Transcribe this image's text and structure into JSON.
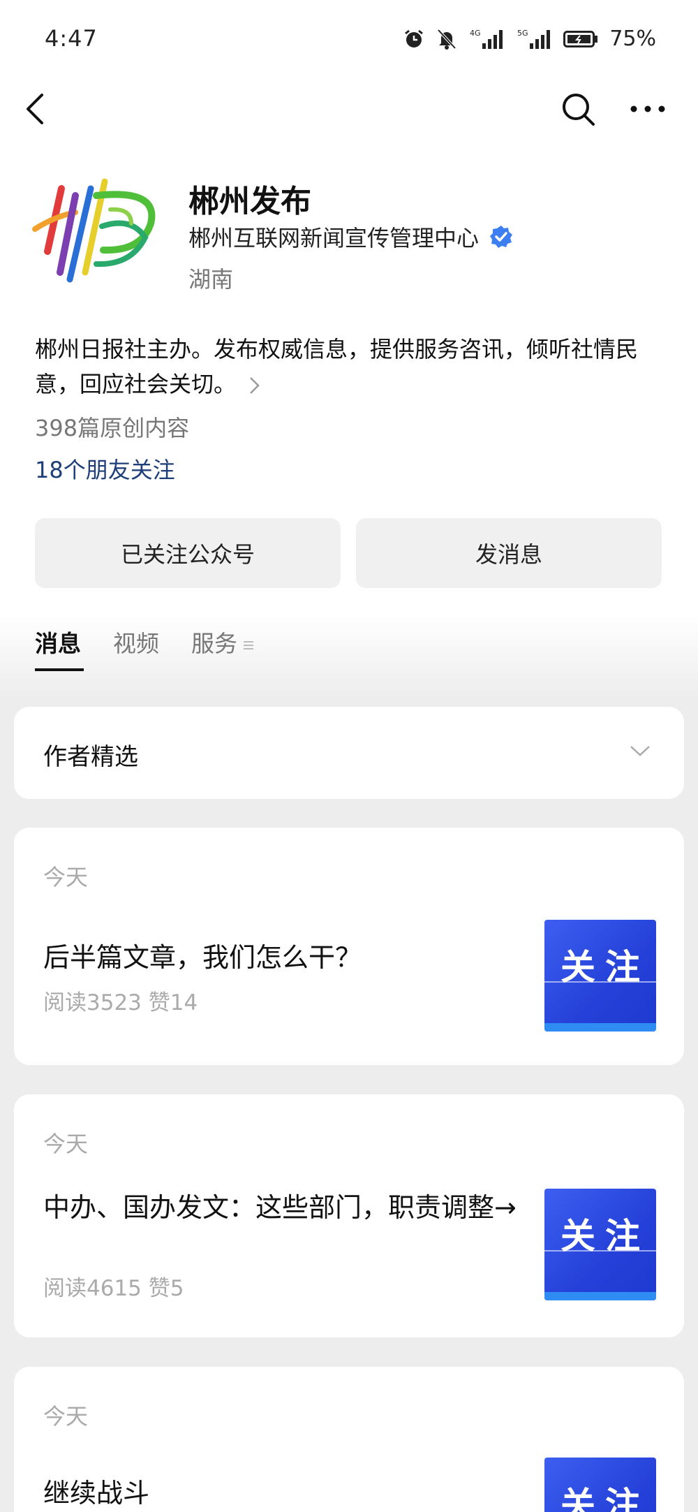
{
  "status": {
    "time": "4:47",
    "signal1_label": "4G",
    "signal2_label": "5G",
    "battery": "75%"
  },
  "account": {
    "name": "郴州发布",
    "org": "郴州互联网新闻宣传管理中心",
    "region": "湖南",
    "description": "郴州日报社主办。发布权威信息，提供服务咨讯，倾听社情民意，回应社会关切。",
    "articles_count": "398篇原创内容",
    "friends_follow": "18个朋友关注"
  },
  "buttons": {
    "followed": "已关注公众号",
    "send_message": "发消息"
  },
  "tabs": [
    {
      "label": "消息",
      "active": true
    },
    {
      "label": "视频",
      "active": false
    },
    {
      "label": "服务",
      "active": false
    }
  ],
  "picks": {
    "label": "作者精选"
  },
  "articles": [
    {
      "date": "今天",
      "title": "后半篇文章，我们怎么干？",
      "stats": "阅读3523  赞14",
      "thumb_text": "关注"
    },
    {
      "date": "今天",
      "title": "中办、国办发文：这些部门，职责调整→",
      "stats": "阅读4615  赞5",
      "thumb_text": "关注"
    },
    {
      "date": "今天",
      "title": "继续战斗",
      "thumb_text": "关注"
    }
  ],
  "colors": {
    "verified": "#3d7ff0",
    "link": "#1d3e78",
    "thumb": "#2440d8"
  },
  "icons": [
    "back-arrow-icon",
    "search-icon",
    "more-icon",
    "verified-icon",
    "chevron-right-icon",
    "chevron-down-icon",
    "menu-lines-icon",
    "alarm-icon",
    "mute-icon",
    "signal-icon",
    "battery-icon"
  ]
}
